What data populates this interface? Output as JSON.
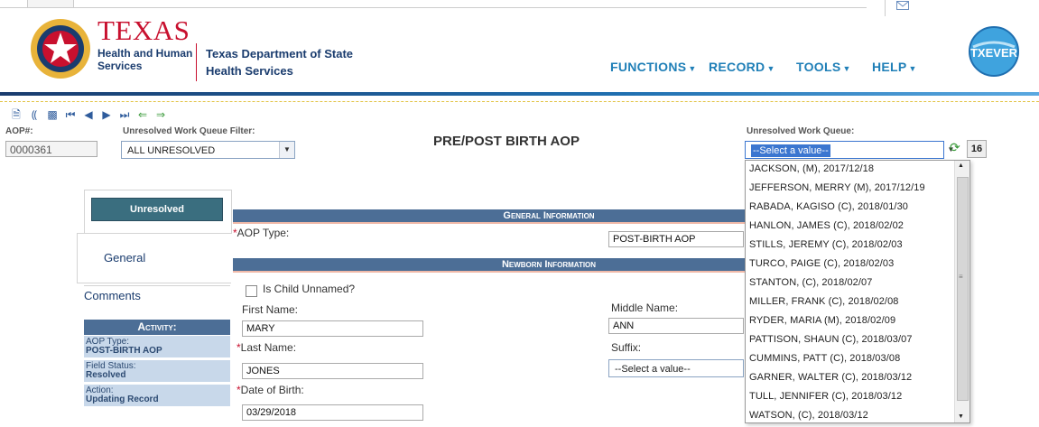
{
  "header": {
    "logo_title": "TEXAS",
    "logo_sub_line1": "Health and Human",
    "logo_sub_line2": "Services",
    "dept_line1": "Texas Department of State",
    "dept_line2": "Health Services",
    "menu": [
      "FUNCTIONS",
      "RECORD",
      "TOOLS",
      "HELP"
    ],
    "app_logo": "TXEVER"
  },
  "toolbar": {
    "icons": [
      "new-document-icon",
      "find-icon",
      "save-icon",
      "first-record-icon",
      "previous-record-icon",
      "next-record-icon",
      "last-record-icon",
      "back-arrow-icon",
      "forward-arrow-icon"
    ],
    "aop_label": "AOP#:",
    "aop_value": "0000361",
    "filter_label": "Unresolved Work Queue Filter:",
    "filter_value": "ALL UNRESOLVED",
    "page_title": "PRE/POST BIRTH AOP",
    "queue_label": "Unresolved Work Queue:",
    "queue_value": "--Select a value--",
    "queue_count": "16"
  },
  "left_panel": {
    "status_button": "Unresolved",
    "tab_general": "General",
    "tab_comments": "Comments",
    "activity_header": "Activity:",
    "aop_type_label": "AOP Type:",
    "aop_type_value": "POST-BIRTH AOP",
    "field_status_label": "Field Status:",
    "field_status_value": "Resolved",
    "action_label": "Action:",
    "action_value": "Updating Record"
  },
  "form": {
    "section_general": "General Information",
    "aop_type_label": "AOP Type:",
    "aop_type_value": "POST-BIRTH AOP",
    "section_newborn": "Newborn Information",
    "unnamed_label": "Is Child Unnamed?",
    "first_name_label": "First Name:",
    "first_name_value": "MARY",
    "last_name_label": "Last Name:",
    "last_name_value": "JONES",
    "dob_label": "Date of Birth:",
    "dob_value": "03/29/2018",
    "middle_name_label": "Middle Name:",
    "middle_name_value": "ANN",
    "suffix_label": "Suffix:",
    "suffix_value": "--Select a value--"
  },
  "queue_list": [
    "JACKSON, (M), 2017/12/18",
    "JEFFERSON, MERRY (M), 2017/12/19",
    "RABADA, KAGISO (C), 2018/01/30",
    "HANLON, JAMES (C), 2018/02/02",
    "STILLS, JEREMY (C), 2018/02/03",
    "TURCO, PAIGE (C), 2018/02/03",
    "STANTON, (C), 2018/02/07",
    "MILLER, FRANK (C), 2018/02/08",
    "RYDER, MARIA (M), 2018/02/09",
    "PATTISON, SHAUN (C), 2018/03/07",
    "CUMMINS, PATT (C), 2018/03/08",
    "GARNER, WALTER (C), 2018/03/12",
    "TULL, JENNIFER (C), 2018/03/12",
    "WATSON, (C), 2018/03/12"
  ],
  "colors": {
    "brand_red": "#c8102e",
    "brand_navy": "#1a3c6e",
    "menu_blue": "#1f7fb7",
    "section_bar": "#4c6e96"
  }
}
